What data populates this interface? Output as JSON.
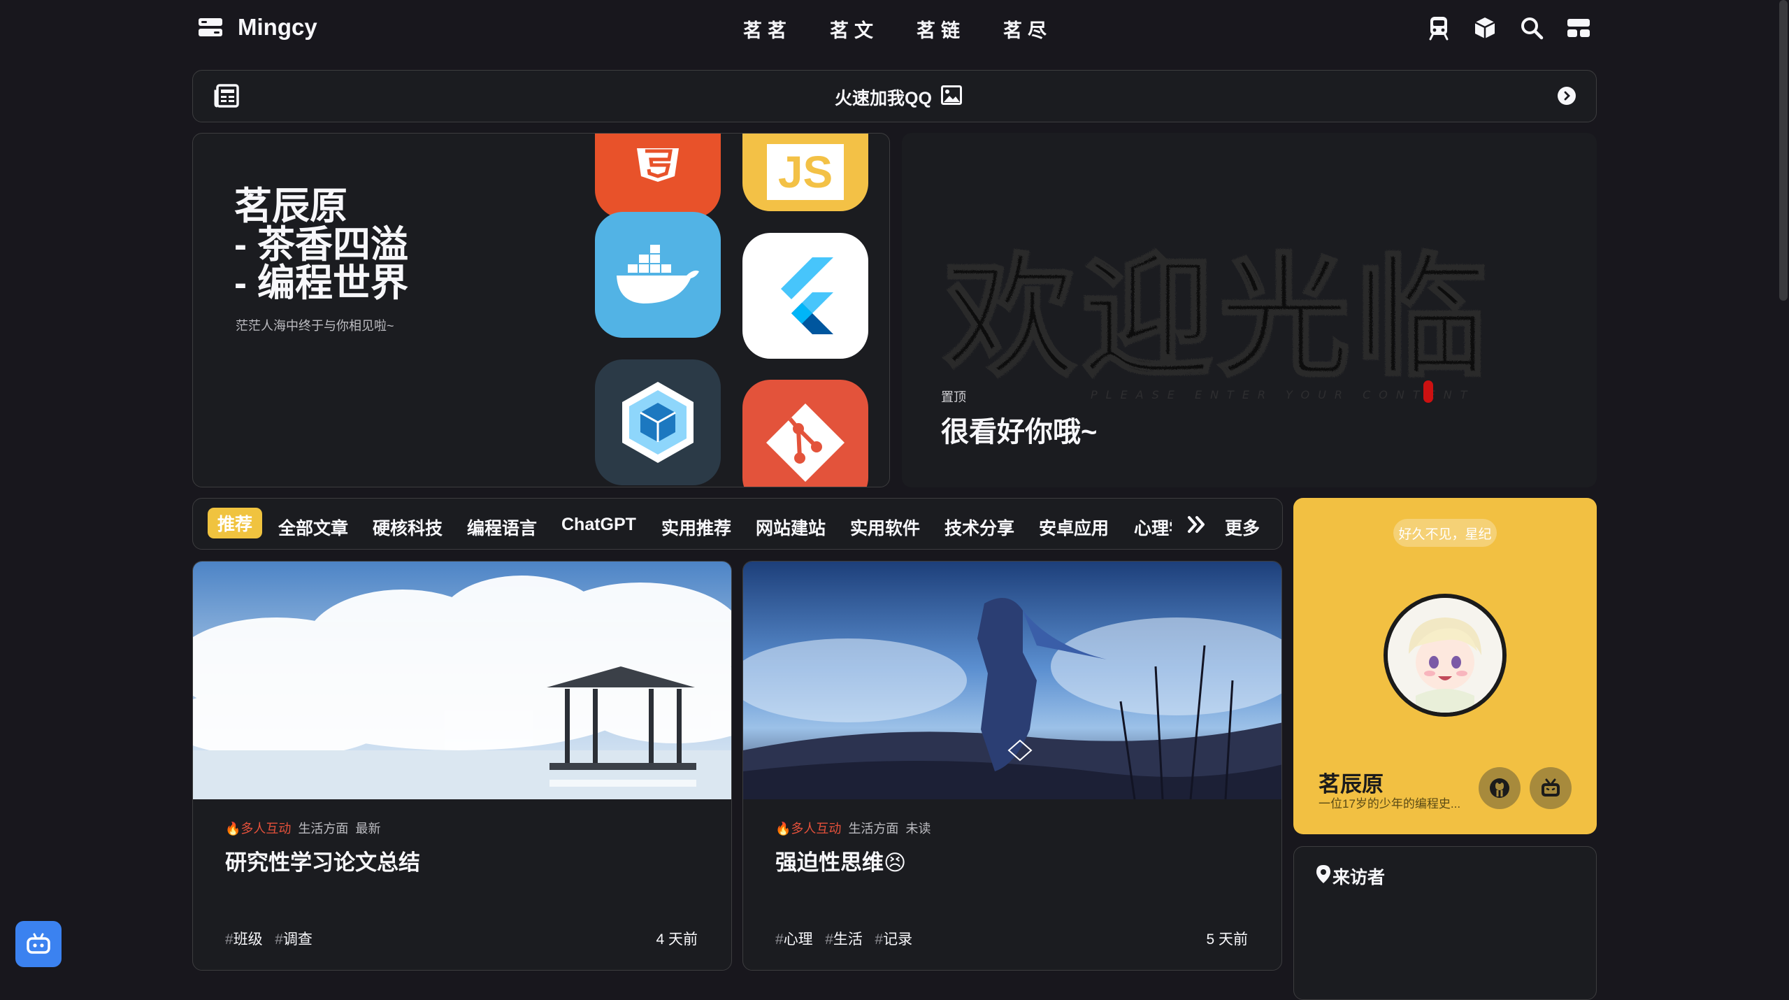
{
  "nav": {
    "logo": "Mingcy",
    "menu": [
      "茗茗",
      "茗文",
      "茗链",
      "茗尽"
    ],
    "icons": [
      "train-icon",
      "cube-icon",
      "search-icon",
      "menu-toggle-icon"
    ]
  },
  "notice": {
    "text": "火速加我QQ"
  },
  "hero": {
    "title_lines": [
      "茗辰原",
      "- 茶香四溢",
      "- 编程世界"
    ],
    "subtitle": "茫茫人海中终于与你相见啦~",
    "tiles": [
      "html5",
      "js",
      "docker",
      "flutter",
      "webpack",
      "git"
    ],
    "tile_js_text": "JS"
  },
  "pinned": {
    "art_text": "欢迎光临",
    "art_subtext": "PLEASE ENTER YOUR CONTENT",
    "label": "置顶",
    "title": "很看好你哦~"
  },
  "categories": {
    "active": "推荐",
    "items": [
      "全部文章",
      "硬核科技",
      "编程语言",
      "ChatGPT",
      "实用推荐",
      "网站建站",
      "实用软件",
      "技术分享",
      "安卓应用"
    ],
    "clipped": "心理学",
    "more": "更多"
  },
  "posts": [
    {
      "hot": "多人互动",
      "category": "生活方面",
      "status": "最新",
      "title": "研究性学习论文总结",
      "tags": [
        "班级",
        "调查"
      ],
      "ago": "4 天前"
    },
    {
      "hot": "多人互动",
      "category": "生活方面",
      "status": "未读",
      "title": "强迫性思维😣",
      "tags": [
        "心理",
        "生活",
        "记录"
      ],
      "ago": "5 天前"
    }
  ],
  "author": {
    "greeting": "好久不见，星纪",
    "name": "茗辰原",
    "description": "一位17岁的少年的编程史..."
  },
  "visitors": {
    "title": "来访者"
  },
  "colors": {
    "background": "#18171d",
    "card": "#1b1c20",
    "accent_yellow": "#f2c042",
    "hot_red": "#e5513b",
    "float_blue": "#3b82f0"
  }
}
